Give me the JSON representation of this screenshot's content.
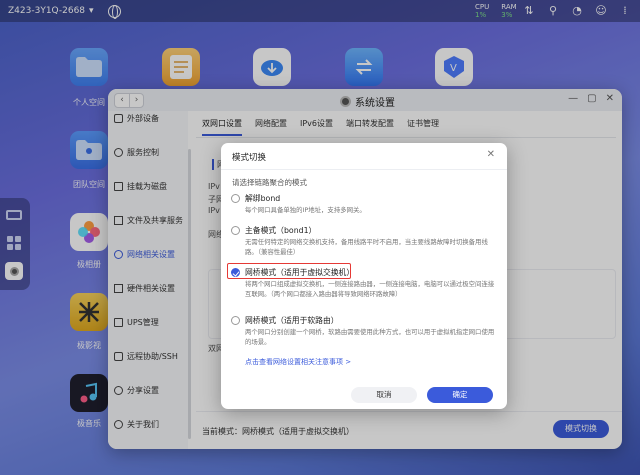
{
  "topbar": {
    "device_name": "Z423-3Y1Q-2668",
    "cpu_label": "CPU",
    "cpu_value": "1%",
    "ram_label": "RAM",
    "ram_value": "3%"
  },
  "desktop": {
    "apps": [
      {
        "label": "个人空间"
      },
      {
        "label": "团队空间"
      },
      {
        "label": "极相册"
      },
      {
        "label": "极影视"
      },
      {
        "label": "极音乐"
      }
    ]
  },
  "window": {
    "title": "系统设置",
    "sidebar": [
      {
        "label": "外部设备"
      },
      {
        "label": "服务控制"
      },
      {
        "label": "挂载为磁盘"
      },
      {
        "label": "文件及共享服务"
      },
      {
        "label": "网络相关设置"
      },
      {
        "label": "硬件相关设置"
      },
      {
        "label": "UPS管理"
      },
      {
        "label": "远程协助/SSH"
      },
      {
        "label": "分享设置"
      },
      {
        "label": "关于我们"
      }
    ],
    "tabs": [
      {
        "label": "双网口设置"
      },
      {
        "label": "网络配置"
      },
      {
        "label": "IPv6设置"
      },
      {
        "label": "端口转发配置"
      },
      {
        "label": "证书管理"
      }
    ],
    "bg_texts": [
      "网",
      "IPv",
      "子网",
      "IPv",
      "网络",
      "双网"
    ],
    "status_text": "当前模式：网桥模式（适用于虚拟交换机）",
    "switch_button": "模式切换"
  },
  "modal": {
    "title": "模式切换",
    "prompt": "请选择链路聚合的模式",
    "options": [
      {
        "title": "解绑bond",
        "desc": "每个网口具备单独的IP地址，支持多网关。",
        "checked": false
      },
      {
        "title": "主备模式（bond1）",
        "desc": "无需任何特定的网络交换机支持，备用线路平时不启用，当主要线路故障时切换备用线路。（兼容性最佳）",
        "checked": false
      },
      {
        "title": "网桥模式（适用于虚拟交换机）",
        "desc": "将两个网口组成虚拟交换机，一侧连接路由器，一侧连接电脑，电脑可以通过极空间连接互联网。（两个网口都接入路由器将导致网络环路故障）",
        "checked": true
      },
      {
        "title": "网桥模式（适用于软路由）",
        "desc": "两个网口分别创建一个网桥，软路由需要使用此种方式，也可以用于虚拟机指定网口使用的场景。",
        "checked": false
      }
    ],
    "link": "点击查看网络设置相关注意事项 >",
    "cancel": "取消",
    "confirm": "确定"
  },
  "colors": {
    "accent": "#3b5bdb",
    "highlight": "#e53935"
  }
}
